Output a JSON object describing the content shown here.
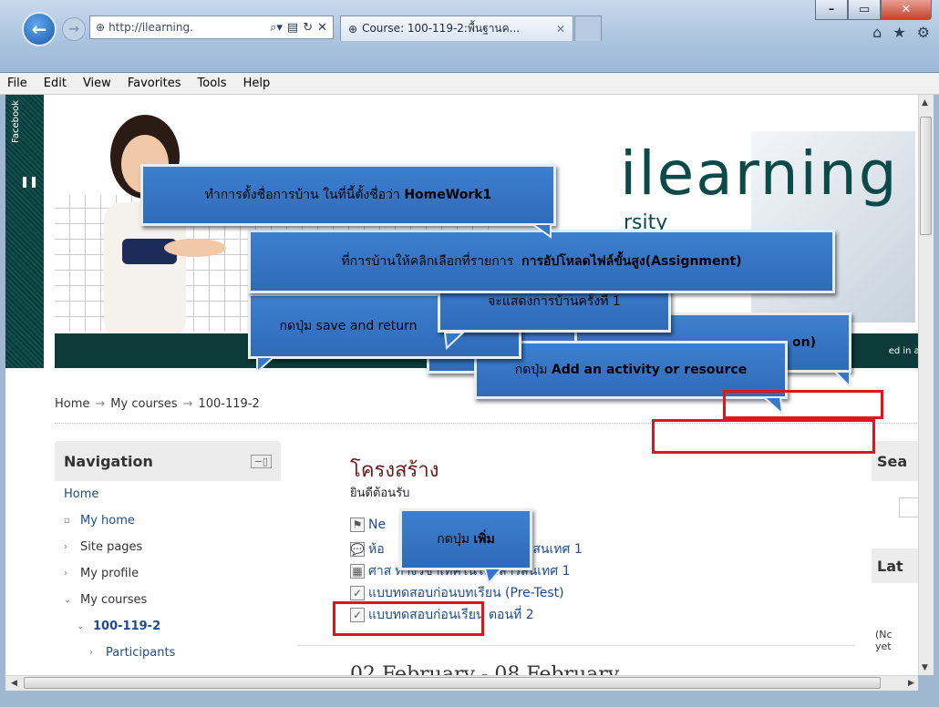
{
  "browser": {
    "address": "http://ilearning.",
    "tab_title": "Course: 100-119-2:พื้นฐานค...",
    "menu": [
      "File",
      "Edit",
      "View",
      "Favorites",
      "Tools",
      "Help"
    ]
  },
  "facebook_strip": {
    "label": "Facebook"
  },
  "banner": {
    "logo": "ilearning",
    "sub": "rsity",
    "logged_in": "ed in as"
  },
  "breadcrumb": [
    "Home",
    "My courses",
    "100-119-2"
  ],
  "navigation": {
    "title": "Navigation",
    "items": [
      {
        "label": "Home"
      },
      {
        "label": "My home"
      },
      {
        "label": "Site pages"
      },
      {
        "label": "My profile"
      },
      {
        "label": "My courses"
      },
      {
        "label": "100-119-2"
      },
      {
        "label": "Participants"
      }
    ]
  },
  "main": {
    "title": "โครงสร้าง",
    "subtitle": "ยินดีต้อนรับ",
    "activities": [
      {
        "label": "Ne"
      },
      {
        "label": "ห้อ",
        "suffix": "ลยีสารสนเทศ 1"
      },
      {
        "label": "ศาส",
        "suffix": "ทางวิชาเทคโนโลยีสารสนเทศ 1"
      },
      {
        "label": "แบบทดสอบก่อนบทเรียน (Pre-Test)"
      },
      {
        "label": "แบบทดสอบก่อนเรียน ตอนที่ 2"
      }
    ],
    "week_title": "02 February - 08 February"
  },
  "right": {
    "search_head": "Sea",
    "latest_head": "Lat",
    "small": [
      "(Nc",
      "yet"
    ]
  },
  "callouts": {
    "c1": "ทำการตั้งชื่อการบ้าน ในที่นี้ตั้งชื่อว่า",
    "c1_bold": "HomeWork1",
    "c2": "ที่การบ้านให้คลิกเลือกที่รายการ",
    "c2_bold": "การอัปโหลดไฟล์ขั้นสูง(Assignment)",
    "c3": "จะแสดงการบ้านครั้งที่ 1",
    "c4": "กดปุ่ม  save and return",
    "c5": "กดปุ่ม",
    "c5_bold": "Add an activity or resource",
    "c6_bold": "on)",
    "c7": "กดปุ่ม",
    "c7_bold": "เพิ่ม"
  },
  "colors": {
    "callout": "#3a7bcc",
    "highlight": "#e0141b",
    "banner_bar": "#0d3b39"
  }
}
